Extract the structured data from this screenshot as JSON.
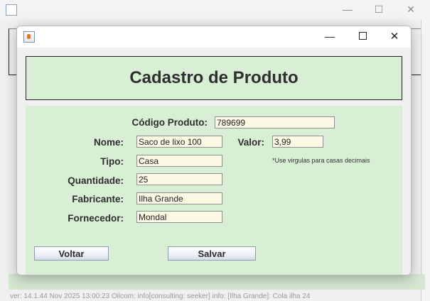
{
  "background_window": {
    "controls": {
      "minimize": "—",
      "maximize": "☐",
      "close": "✕"
    },
    "status_text": "ver: 14.1.44 Nov 2025 13:00:23  Oilcom: info[consulting: seeker]  info: [Ilha Grande]: Cola ilha 24"
  },
  "dialog": {
    "controls": {
      "minimize": "—",
      "close": "✕"
    }
  },
  "header": {
    "title": "Cadastro de Produto"
  },
  "form": {
    "codigo": {
      "label": "Código Produto:",
      "value": "789699"
    },
    "nome": {
      "label": "Nome:",
      "value": "Saco de lixo 100"
    },
    "valor": {
      "label": "Valor:",
      "value": "3,99"
    },
    "valor_hint": "*Use virgulas para casas decimais",
    "tipo": {
      "label": "Tipo:",
      "value": "Casa"
    },
    "quantidade": {
      "label": "Quantidade:",
      "value": "25"
    },
    "fabricante": {
      "label": "Fabricante:",
      "value": "Ilha Grande"
    },
    "fornecedor": {
      "label": "Fornecedor:",
      "value": "Mondal"
    }
  },
  "buttons": {
    "voltar": "Voltar",
    "salvar": "Salvar"
  },
  "colors": {
    "panel_green": "#d8efd5",
    "field_bg": "#fbf8e4"
  }
}
